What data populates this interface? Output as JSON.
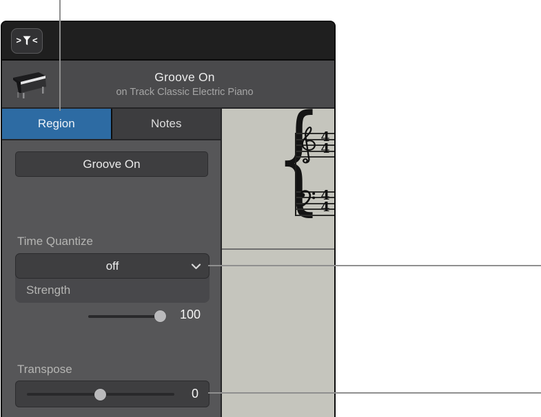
{
  "colors": {
    "accent": "#2d6ba3",
    "panel_bg": "#565658",
    "topbar_bg": "#1f1f1f",
    "header_bg": "#4a4a4c",
    "control_bg": "#3e3e40",
    "group_bg": "#48484b",
    "notation_bg": "#c5c5bd",
    "callout": "#8f8f8f"
  },
  "icons": {
    "filter_left_glyph": ">",
    "filter_right_glyph": "<",
    "brace_glyph": "{"
  },
  "header": {
    "title": "Groove On",
    "subtitle": "on Track Classic Electric Piano"
  },
  "tabs": [
    {
      "label": "Region",
      "active": true
    },
    {
      "label": "Notes",
      "active": false
    }
  ],
  "inspector": {
    "name_value": "Groove On",
    "time_quantize_label": "Time Quantize",
    "quantize_value": "off",
    "strength_label": "Strength",
    "strength_value": "100",
    "transpose_label": "Transpose",
    "transpose_value": "0"
  },
  "notation": {
    "time_signature_top": "4",
    "time_signature_bottom": "4"
  }
}
